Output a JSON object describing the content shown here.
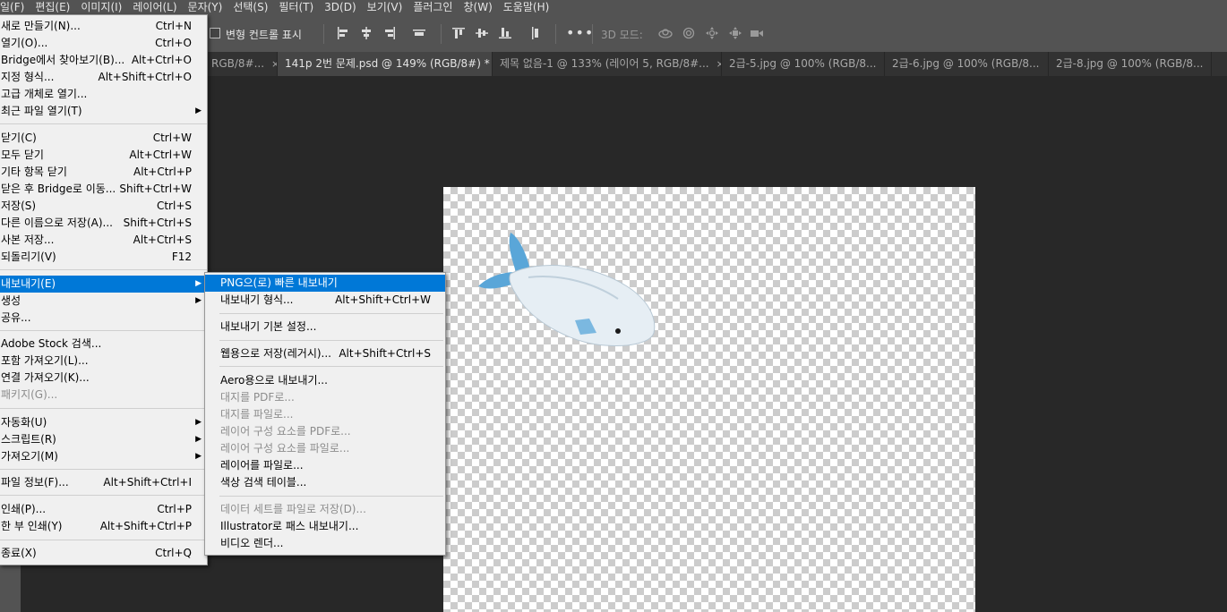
{
  "menubar": [
    "일(F)",
    "편집(E)",
    "이미지(I)",
    "레이어(L)",
    "문자(Y)",
    "선택(S)",
    "필터(T)",
    "3D(D)",
    "보기(V)",
    "플러그인",
    "창(W)",
    "도움말(H)"
  ],
  "options": {
    "transform_label": "변형 컨트롤 표시",
    "more": "•••",
    "mode3d_label": "3D 모드:"
  },
  "tabs": [
    {
      "label": "RGB/8#...",
      "close": "×"
    },
    {
      "label": "141p 2번 문제.psd @ 149% (RGB/8#) *",
      "close": "×"
    },
    {
      "label": "제목 없음-1 @ 133% (레이어 5, RGB/8#...",
      "close": "×"
    },
    {
      "label": "2급-5.jpg @ 100% (RGB/8...",
      "close": "×"
    },
    {
      "label": "2급-6.jpg @ 100% (RGB/8...",
      "close": "×"
    },
    {
      "label": "2급-8.jpg @ 100% (RGB/8...",
      "close": "×"
    }
  ],
  "file_menu": [
    {
      "label": "새로 만들기(N)...",
      "shortcut": "Ctrl+N"
    },
    {
      "label": "열기(O)...",
      "shortcut": "Ctrl+O"
    },
    {
      "label": "Bridge에서 찾아보기(B)...",
      "shortcut": "Alt+Ctrl+O"
    },
    {
      "label": "지정 형식...",
      "shortcut": "Alt+Shift+Ctrl+O"
    },
    {
      "label": "고급 개체로 열기...",
      "shortcut": ""
    },
    {
      "label": "최근 파일 열기(T)",
      "shortcut": "",
      "arrow": "▶"
    },
    {
      "label": "닫기(C)",
      "shortcut": "Ctrl+W"
    },
    {
      "label": "모두 닫기",
      "shortcut": "Alt+Ctrl+W"
    },
    {
      "label": "기타 항목 닫기",
      "shortcut": "Alt+Ctrl+P"
    },
    {
      "label": "닫은 후 Bridge로 이동...",
      "shortcut": "Shift+Ctrl+W"
    },
    {
      "label": "저장(S)",
      "shortcut": "Ctrl+S"
    },
    {
      "label": "다른 이름으로 저장(A)...",
      "shortcut": "Shift+Ctrl+S"
    },
    {
      "label": "사본 저장...",
      "shortcut": "Alt+Ctrl+S"
    },
    {
      "label": "되돌리기(V)",
      "shortcut": "F12"
    },
    {
      "label": "내보내기(E)",
      "shortcut": "",
      "arrow": "▶"
    },
    {
      "label": "생성",
      "shortcut": "",
      "arrow": "▶"
    },
    {
      "label": "공유...",
      "shortcut": ""
    },
    {
      "label": "Adobe Stock 검색...",
      "shortcut": ""
    },
    {
      "label": "포함 가져오기(L)...",
      "shortcut": ""
    },
    {
      "label": "연결 가져오기(K)...",
      "shortcut": ""
    },
    {
      "label": "패키지(G)...",
      "shortcut": ""
    },
    {
      "label": "자동화(U)",
      "shortcut": "",
      "arrow": "▶"
    },
    {
      "label": "스크립트(R)",
      "shortcut": "",
      "arrow": "▶"
    },
    {
      "label": "가져오기(M)",
      "shortcut": "",
      "arrow": "▶"
    },
    {
      "label": "파일 정보(F)...",
      "shortcut": "Alt+Shift+Ctrl+I"
    },
    {
      "label": "인쇄(P)...",
      "shortcut": "Ctrl+P"
    },
    {
      "label": "한 부 인쇄(Y)",
      "shortcut": "Alt+Shift+Ctrl+P"
    },
    {
      "label": "종료(X)",
      "shortcut": "Ctrl+Q"
    }
  ],
  "export_submenu": [
    {
      "label": "PNG으(로) 빠른 내보내기",
      "shortcut": ""
    },
    {
      "label": "내보내기 형식...",
      "shortcut": "Alt+Shift+Ctrl+W"
    },
    {
      "label": "내보내기 기본 설정...",
      "shortcut": ""
    },
    {
      "label": "웹용으로 저장(레거시)...",
      "shortcut": "Alt+Shift+Ctrl+S"
    },
    {
      "label": "Aero용으로 내보내기...",
      "shortcut": ""
    },
    {
      "label": "대지를 PDF로...",
      "shortcut": ""
    },
    {
      "label": "대지를 파일로...",
      "shortcut": ""
    },
    {
      "label": "레이어 구성 요소를 PDF로...",
      "shortcut": ""
    },
    {
      "label": "레이어 구성 요소를 파일로...",
      "shortcut": ""
    },
    {
      "label": "레이어를 파일로...",
      "shortcut": ""
    },
    {
      "label": "색상 검색 테이블...",
      "shortcut": ""
    },
    {
      "label": "데이터 세트를 파일로 저장(D)...",
      "shortcut": ""
    },
    {
      "label": "Illustrator로 패스 내보내기...",
      "shortcut": ""
    },
    {
      "label": "비디오 렌더...",
      "shortcut": ""
    }
  ],
  "colors": {
    "highlight": "#0078d7",
    "ui_dark": "#535353",
    "workspace": "#282828"
  }
}
